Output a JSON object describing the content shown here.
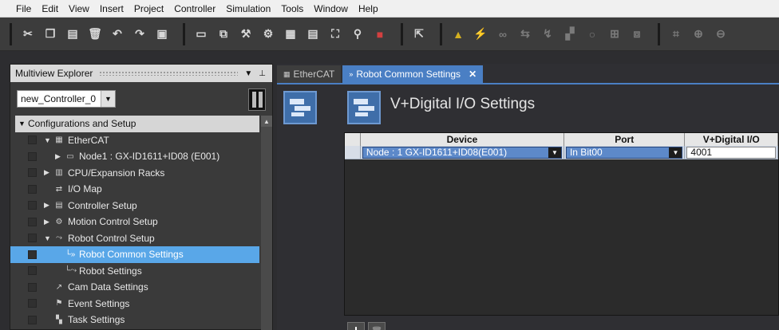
{
  "menu": [
    "File",
    "Edit",
    "View",
    "Insert",
    "Project",
    "Controller",
    "Simulation",
    "Tools",
    "Window",
    "Help"
  ],
  "explorer": {
    "title": "Multiview Explorer",
    "controller": "new_Controller_0",
    "tree": [
      {
        "label": "Configurations and Setup",
        "exp": "▼",
        "icon": "",
        "level": 0,
        "root": true
      },
      {
        "label": "EtherCAT",
        "exp": "▼",
        "icon": "▦",
        "level": 1
      },
      {
        "label": "Node1 : GX-ID1611+ID08 (E001)",
        "exp": "▶",
        "icon": "▭",
        "level": 2
      },
      {
        "label": "CPU/Expansion Racks",
        "exp": "▶",
        "icon": "▥",
        "level": 1
      },
      {
        "label": "I/O Map",
        "exp": "",
        "icon": "⇄",
        "level": 1
      },
      {
        "label": "Controller Setup",
        "exp": "▶",
        "icon": "▤",
        "level": 1
      },
      {
        "label": "Motion Control Setup",
        "exp": "▶",
        "icon": "⚙",
        "level": 1
      },
      {
        "label": "Robot Control Setup",
        "exp": "▼",
        "icon": "⤳",
        "level": 1
      },
      {
        "label": "Robot Common Settings",
        "exp": "",
        "icon": "└»",
        "level": 2,
        "selected": true
      },
      {
        "label": "Robot Settings",
        "exp": "",
        "icon": "└⤳",
        "level": 2
      },
      {
        "label": "Cam Data Settings",
        "exp": "",
        "icon": "↗",
        "level": 1
      },
      {
        "label": "Event Settings",
        "exp": "",
        "icon": "⚑",
        "level": 1
      },
      {
        "label": "Task Settings",
        "exp": "",
        "icon": "▚",
        "level": 1
      }
    ]
  },
  "tabs": {
    "ethercat": "EtherCAT",
    "robot_common": "Robot Common Settings"
  },
  "editor": {
    "title": "V+Digital I/O Settings",
    "columns": {
      "device": "Device",
      "port": "Port",
      "dio": "V+Digital I/O"
    },
    "rows": [
      {
        "device": "Node : 1 GX-ID1611+ID08(E001)",
        "port": "In Bit00",
        "dio": "4001"
      }
    ]
  }
}
